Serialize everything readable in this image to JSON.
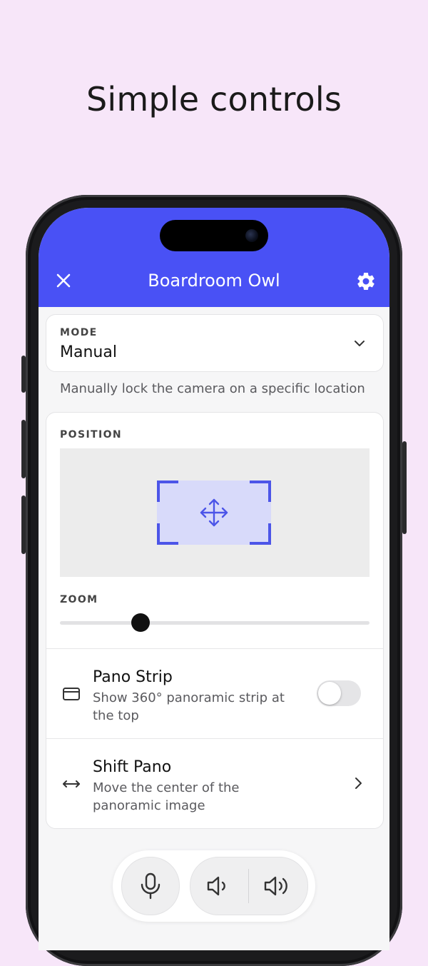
{
  "headline": "Simple controls",
  "header": {
    "title": "Boardroom Owl",
    "close_icon": "close-icon",
    "settings_icon": "gear-icon",
    "color": "#4951f5"
  },
  "mode": {
    "label": "MODE",
    "value": "Manual",
    "description": "Manually lock the camera on a specific location"
  },
  "position": {
    "label": "POSITION"
  },
  "zoom": {
    "label": "ZOOM",
    "level_fraction": 0.26
  },
  "settings_rows": [
    {
      "title": "Pano Strip",
      "subtitle": "Show 360° panoramic strip at the top",
      "icon": "panorama-strip-icon",
      "toggle_on": false
    },
    {
      "title": "Shift Pano",
      "subtitle": "Move the center of the panoramic image",
      "icon": "horizontal-arrows-icon"
    }
  ],
  "audio_controls": {
    "mic_icon": "microphone-icon",
    "volume_down_icon": "volume-down-icon",
    "volume_up_icon": "volume-up-icon"
  },
  "colors": {
    "background": "#f7e6f9",
    "accent": "#4c55e8"
  }
}
